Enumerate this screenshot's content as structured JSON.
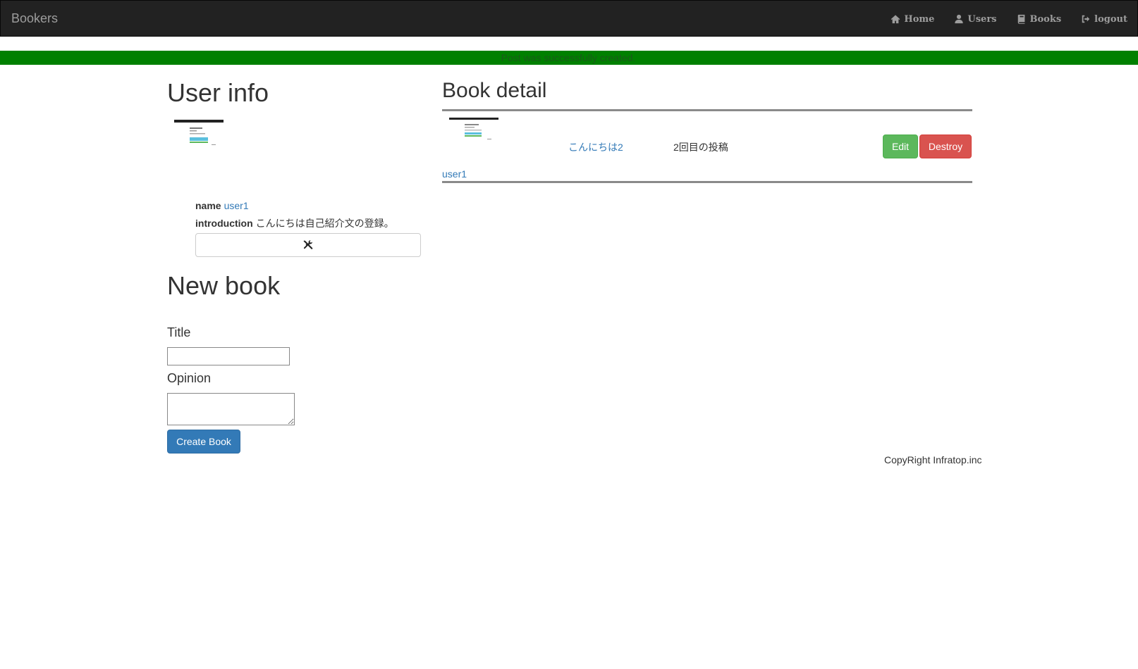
{
  "nav": {
    "brand": "Bookers",
    "items": [
      {
        "label": "Home",
        "icon": "home-icon"
      },
      {
        "label": "Users",
        "icon": "user-icon"
      },
      {
        "label": "Books",
        "icon": "book-icon"
      },
      {
        "label": "logout",
        "icon": "logout-icon"
      }
    ]
  },
  "flash": {
    "message": "Post was successfully created."
  },
  "user_info": {
    "heading": "User info",
    "name_key": "name",
    "name_value": "user1",
    "introduction_key": "introduction",
    "introduction_value": "こんにちは自己紹介文の登録。",
    "edit_icon": "wrench-icon"
  },
  "new_book": {
    "heading": "New book",
    "title_label": "Title",
    "title_value": "",
    "opinion_label": "Opinion",
    "opinion_value": "",
    "submit_label": "Create Book"
  },
  "book_detail": {
    "heading": "Book detail",
    "title": "こんにちは2",
    "body": "2回目の投稿",
    "edit_label": "Edit",
    "destroy_label": "Destroy",
    "user": "user1"
  },
  "footer": {
    "text": "CopyRight Infratop.inc"
  },
  "colors": {
    "navbar": "#222222",
    "flash": "#008000",
    "link": "#337ab7",
    "primary": "#337ab7",
    "success": "#5cb85c",
    "danger": "#d9534f"
  }
}
